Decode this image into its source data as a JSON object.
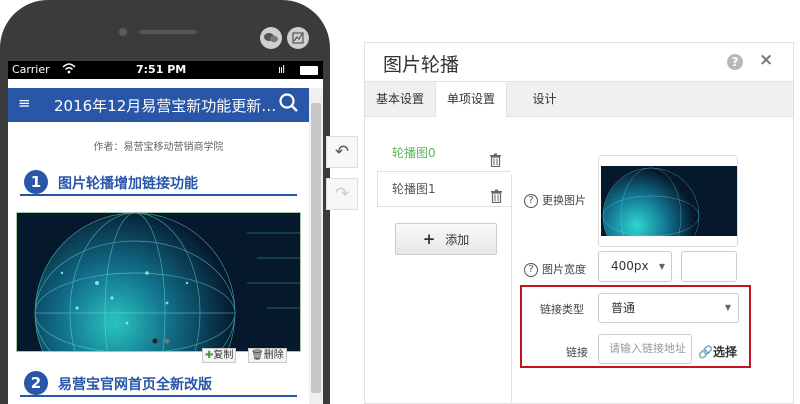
{
  "phone": {
    "round_buttons": [
      "chat-icon",
      "chart-icon"
    ],
    "status": {
      "carrier": "Carrier",
      "time": "7:51 PM",
      "signal": "ııl"
    },
    "appbar": {
      "menu_icon": "≡",
      "title": "2016年12月易营宝新功能更新…"
    },
    "article": {
      "author": "作者：易营宝移动营销商学院",
      "section1": {
        "num": "1",
        "title": "图片轮播增加链接功能"
      },
      "section2": {
        "num": "2",
        "title": "易营宝官网首页全新改版"
      },
      "copy_label": "复制",
      "delete_label": "删除"
    }
  },
  "editor": {
    "undo_icon": "↶",
    "redo_icon": "↷",
    "title": "图片轮播",
    "help_icon": "?",
    "close_icon": "×",
    "tabs": [
      "基本设置",
      "单项设置",
      "设计"
    ],
    "active_tab": "单项设置",
    "carousel_items": [
      "轮播图0",
      "轮播图1"
    ],
    "active_item": "轮播图0",
    "add_label": "添加",
    "fields": {
      "change_image": "更换图片",
      "image_width": "图片宽度",
      "width_value": "400px",
      "link_type_label": "链接类型",
      "link_type_value": "普通",
      "link_label": "链接",
      "link_placeholder": "请输入链接地址",
      "choose_label": "选择"
    },
    "colors": {
      "accent_blue": "#2a56a8",
      "active_green": "#5cb85c",
      "highlight_red": "#c0171f"
    }
  }
}
